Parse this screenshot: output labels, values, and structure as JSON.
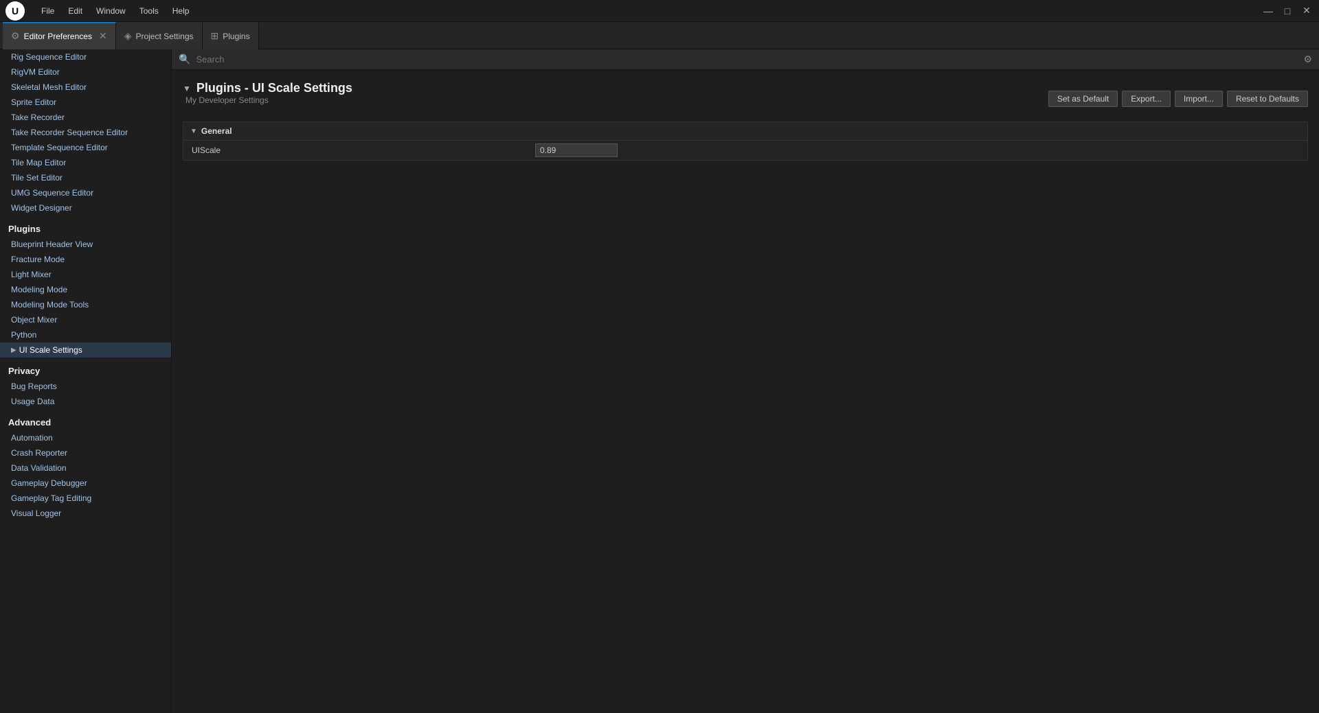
{
  "titlebar": {
    "menu_items": [
      "File",
      "Edit",
      "Window",
      "Tools",
      "Help"
    ],
    "win_minimize": "—",
    "win_restore": "□",
    "win_close": "✕"
  },
  "tabs": [
    {
      "id": "editor-preferences",
      "icon": "⚙",
      "label": "Editor Preferences",
      "closable": true,
      "active": true
    },
    {
      "id": "project-settings",
      "icon": "◈",
      "label": "Project Settings",
      "closable": false,
      "active": false
    },
    {
      "id": "plugins",
      "icon": "⊞",
      "label": "Plugins",
      "closable": false,
      "active": false
    }
  ],
  "sidebar": {
    "sections": [
      {
        "id": "editors-section",
        "label": null,
        "items": [
          {
            "id": "rig-sequence-editor",
            "label": "Rig Sequence Editor"
          },
          {
            "id": "rigvm-editor",
            "label": "RigVM Editor"
          },
          {
            "id": "skeletal-mesh-editor",
            "label": "Skeletal Mesh Editor"
          },
          {
            "id": "sprite-editor",
            "label": "Sprite Editor"
          },
          {
            "id": "take-recorder",
            "label": "Take Recorder"
          },
          {
            "id": "take-recorder-sequence-editor",
            "label": "Take Recorder Sequence Editor"
          },
          {
            "id": "template-sequence-editor",
            "label": "Template Sequence Editor"
          },
          {
            "id": "tile-map-editor",
            "label": "Tile Map Editor"
          },
          {
            "id": "tile-set-editor",
            "label": "Tile Set Editor"
          },
          {
            "id": "umg-sequence-editor",
            "label": "UMG Sequence Editor"
          },
          {
            "id": "widget-designer",
            "label": "Widget Designer"
          }
        ]
      },
      {
        "id": "plugins-section",
        "label": "Plugins",
        "items": [
          {
            "id": "blueprint-header-view",
            "label": "Blueprint Header View"
          },
          {
            "id": "fracture-mode",
            "label": "Fracture Mode"
          },
          {
            "id": "light-mixer",
            "label": "Light Mixer"
          },
          {
            "id": "modeling-mode",
            "label": "Modeling Mode"
          },
          {
            "id": "modeling-mode-tools",
            "label": "Modeling Mode Tools"
          },
          {
            "id": "object-mixer",
            "label": "Object Mixer"
          },
          {
            "id": "python",
            "label": "Python"
          },
          {
            "id": "ui-scale-settings",
            "label": "UI Scale Settings",
            "active": true,
            "hasArrow": true
          }
        ]
      },
      {
        "id": "privacy-section",
        "label": "Privacy",
        "items": [
          {
            "id": "bug-reports",
            "label": "Bug Reports"
          },
          {
            "id": "usage-data",
            "label": "Usage Data"
          }
        ]
      },
      {
        "id": "advanced-section",
        "label": "Advanced",
        "items": [
          {
            "id": "automation",
            "label": "Automation"
          },
          {
            "id": "crash-reporter",
            "label": "Crash Reporter"
          },
          {
            "id": "data-validation",
            "label": "Data Validation"
          },
          {
            "id": "gameplay-debugger",
            "label": "Gameplay Debugger"
          },
          {
            "id": "gameplay-tag-editing",
            "label": "Gameplay Tag Editing"
          },
          {
            "id": "visual-logger",
            "label": "Visual Logger"
          }
        ]
      }
    ]
  },
  "search": {
    "placeholder": "Search"
  },
  "content": {
    "page_title": "Plugins - UI Scale Settings",
    "page_subtitle": "My Developer Settings",
    "actions": {
      "set_as_default": "Set as Default",
      "export": "Export...",
      "import": "Import...",
      "reset_to_defaults": "Reset to Defaults"
    },
    "sections": [
      {
        "id": "general",
        "label": "General",
        "expanded": true,
        "rows": [
          {
            "id": "ui-scale",
            "label": "UIScale",
            "value": "0.89"
          }
        ]
      }
    ]
  }
}
